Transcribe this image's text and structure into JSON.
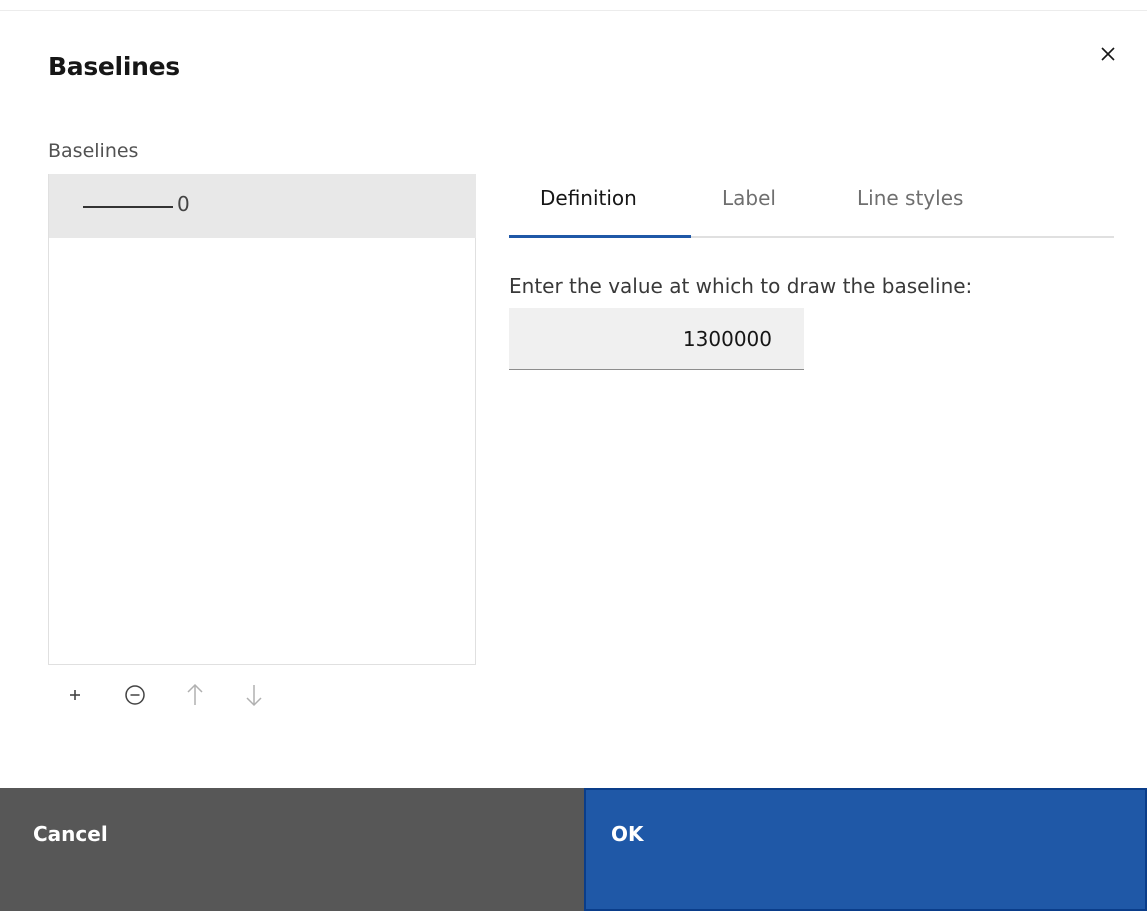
{
  "dialog": {
    "title": "Baselines"
  },
  "baselines_list": {
    "label": "Baselines",
    "items": [
      {
        "label": "0"
      }
    ]
  },
  "toolbar": {
    "add_icon": "plus-icon",
    "remove_icon": "minus-circle-icon",
    "up_icon": "arrow-up-icon",
    "down_icon": "arrow-down-icon"
  },
  "tabs": [
    {
      "label": "Definition",
      "active": true
    },
    {
      "label": "Label",
      "active": false
    },
    {
      "label": "Line styles",
      "active": false
    }
  ],
  "definition": {
    "prompt": "Enter the value at which to draw the baseline:",
    "value": "1300000"
  },
  "buttons": {
    "cancel": "Cancel",
    "ok": "OK"
  },
  "colors": {
    "primary": "#1f58a7",
    "secondary": "#575757"
  }
}
